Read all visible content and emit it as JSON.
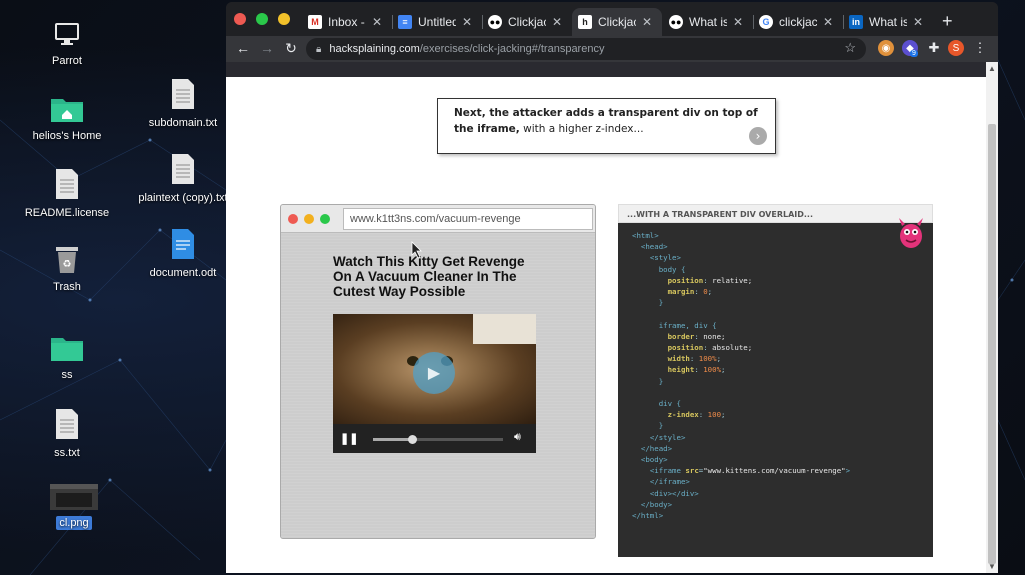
{
  "desktop": {
    "icons": [
      {
        "label": "Parrot",
        "icon": "monitor-icon"
      },
      {
        "label": "helios's Home",
        "icon": "home-folder-icon"
      },
      {
        "label": "README.license",
        "icon": "text-file-icon"
      },
      {
        "label": "Trash",
        "icon": "trash-icon"
      },
      {
        "label": "ss",
        "icon": "folder-icon"
      },
      {
        "label": "ss.txt",
        "icon": "text-file-icon"
      },
      {
        "label": "cl.png",
        "icon": "image-file-icon"
      },
      {
        "label": "subdomain.txt",
        "icon": "text-file-icon"
      },
      {
        "label": "plaintext (copy).txt",
        "icon": "text-file-icon"
      },
      {
        "label": "document.odt",
        "icon": "document-icon"
      }
    ]
  },
  "browser": {
    "tabs": [
      {
        "title": "Inbox - s",
        "favicon": "gmail-icon",
        "active": false
      },
      {
        "title": "Untitled",
        "favicon": "docs-icon",
        "active": false
      },
      {
        "title": "Clickjack",
        "favicon": "medium-icon",
        "active": false
      },
      {
        "title": "Clickjack",
        "favicon": "hacksplaining-icon",
        "active": true
      },
      {
        "title": "What is",
        "favicon": "medium-icon",
        "active": false
      },
      {
        "title": "clickjack",
        "favicon": "google-icon",
        "active": false
      },
      {
        "title": "What is",
        "favicon": "linkedin-icon",
        "active": false
      }
    ],
    "url_host": "hacksplaining.com",
    "url_path": "/exercises/click-jacking#/transparency",
    "extension_badge": "9",
    "profile_initial": "S"
  },
  "callout": {
    "bold": "Next, the attacker adds a transparent div on top of the iframe,",
    "rest": " with a higher z-index..."
  },
  "mock_browser": {
    "url": "www.k1tt3ns.com/vacuum-revenge",
    "title": "Watch This Kitty Get Revenge On A Vacuum Cleaner In The Cutest Way Possible",
    "progress": 0.3
  },
  "code_panel": {
    "heading": "...WITH A TRANSPARENT DIV OVERLAID...",
    "code": {
      "l1": "<html>",
      "l2": "<head>",
      "l3": "<style>",
      "l4": "body {",
      "l5a": "position",
      "l5b": "relative;",
      "l6a": "margin",
      "l6b": "0",
      "l7": "}",
      "l8": "iframe, div {",
      "l9a": "border",
      "l9b": "none;",
      "l10a": "position",
      "l10b": "absolute;",
      "l11a": "width",
      "l11b": "100%",
      "l12a": "height",
      "l12b": "100%",
      "l13": "}",
      "l14": "div {",
      "l15a": "z-index",
      "l15b": "100",
      "l16": "}",
      "l17": "</style>",
      "l18": "</head>",
      "l19": "<body>",
      "l20a": "<iframe ",
      "l20b": "src",
      "l20c": "\"www.kittens.com/vacuum-revenge\"",
      "l21": "</iframe>",
      "l22": "<div></div>",
      "l23": "</body>",
      "l24": "</html>"
    }
  }
}
